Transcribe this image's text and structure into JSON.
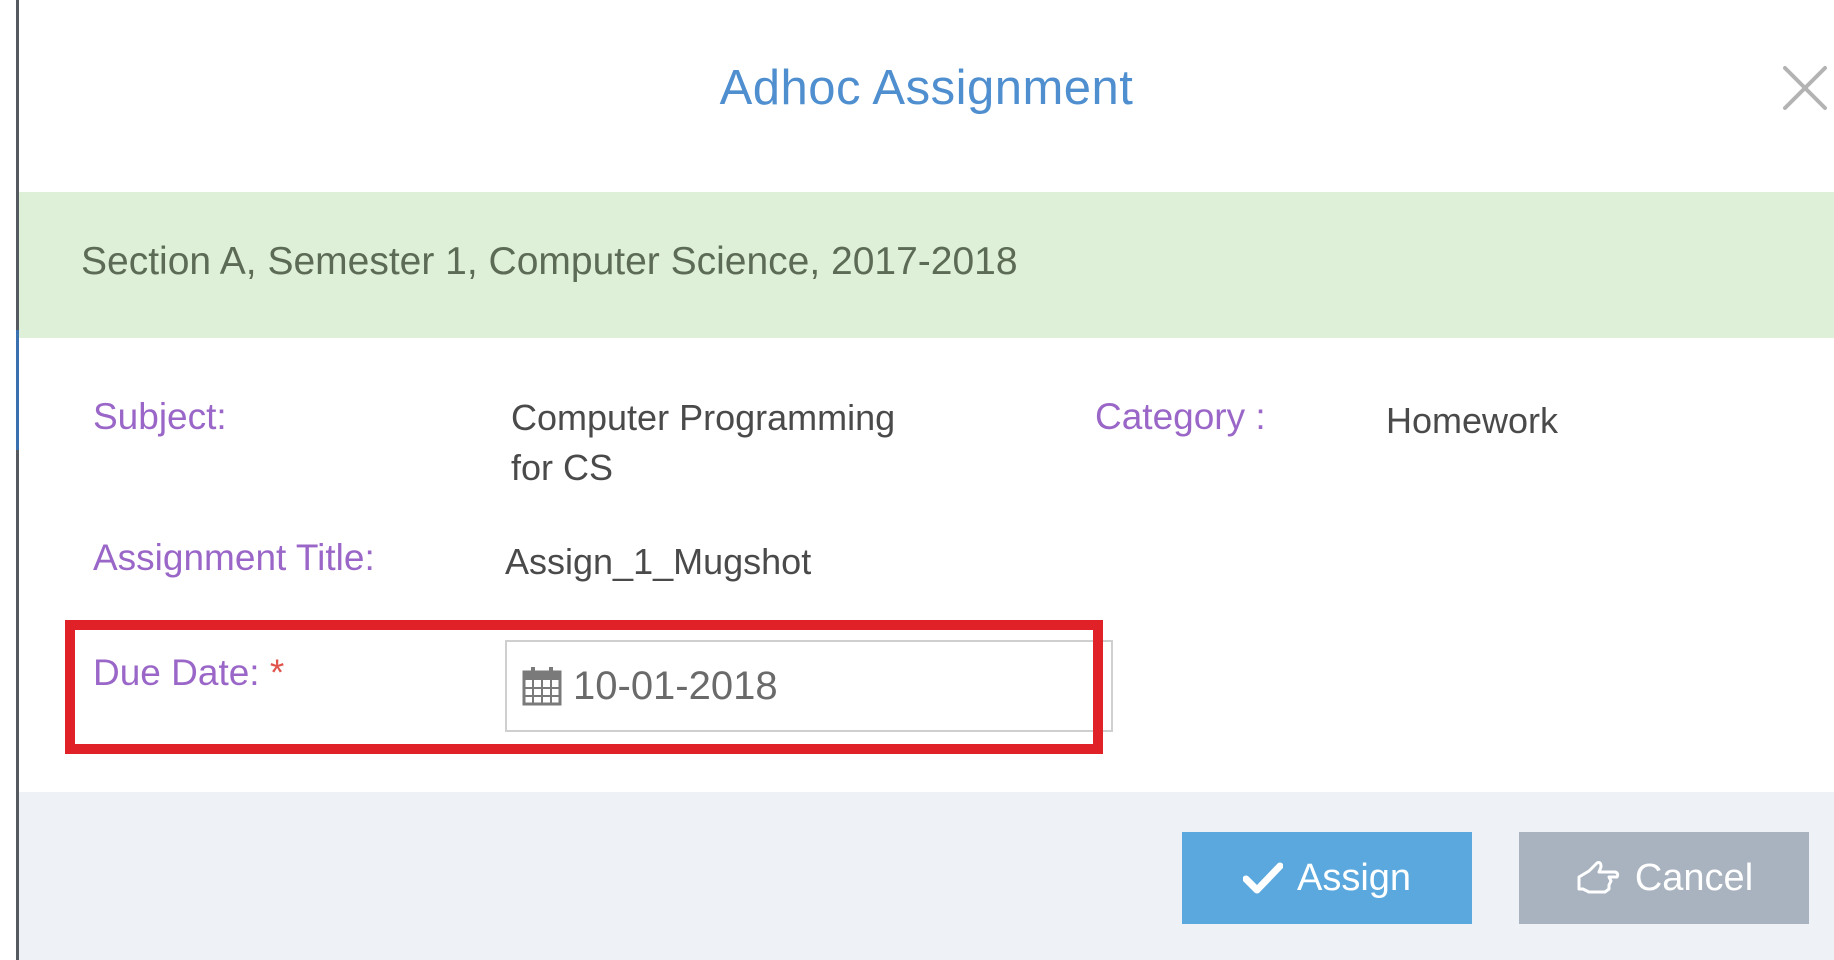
{
  "modal": {
    "title": "Adhoc Assignment",
    "close_icon": "close-icon"
  },
  "section_banner": {
    "text": "Section A, Semester 1,  Computer Science, 2017-2018"
  },
  "form": {
    "subject_label": "Subject:",
    "subject_value_line1": "Computer Programming",
    "subject_value_line2": "for CS",
    "category_label": "Category :",
    "category_value": "Homework",
    "title_label": "Assignment Title:",
    "title_value": "Assign_1_Mugshot",
    "due_date_label": "Due Date: ",
    "due_date_required": "*",
    "due_date_value": "10-01-2018",
    "due_date_icon": "calendar-icon"
  },
  "footer": {
    "assign_label": "Assign",
    "assign_icon": "check-icon",
    "cancel_label": "Cancel",
    "cancel_icon": "hand-pointer-icon"
  },
  "colors": {
    "title": "#4f8fcf",
    "banner_bg": "#dff0d8",
    "label": "#9a67c8",
    "highlight": "#e02228",
    "assign_button": "#5ba8de",
    "cancel_button": "#a8b3bf",
    "footer_bg": "#eef1f5"
  }
}
